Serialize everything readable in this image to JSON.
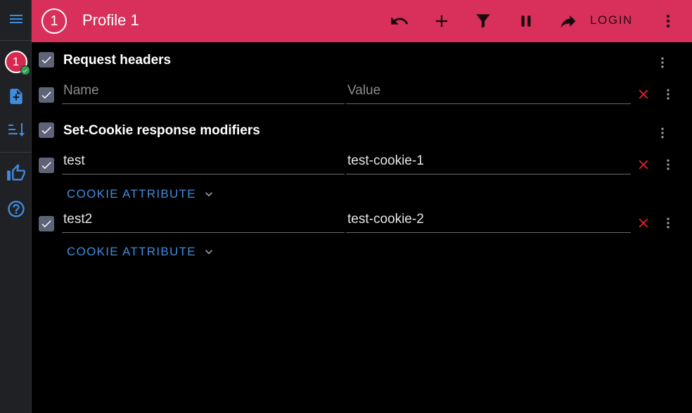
{
  "sidebar": {
    "profile_number": "1",
    "icons": [
      "menu-icon",
      "add-file-icon",
      "sort-icon",
      "thumbs-up-icon",
      "help-icon"
    ]
  },
  "topbar": {
    "profile_number": "1",
    "title": "Profile 1",
    "login_label": "LOGIN",
    "icons": [
      "undo-icon",
      "add-icon",
      "filter-icon",
      "pause-icon",
      "share-icon",
      "more-vert-icon"
    ]
  },
  "request_headers": {
    "title": "Request headers",
    "name_placeholder": "Name",
    "value_placeholder": "Value"
  },
  "cookie_modifiers": {
    "title": "Set-Cookie response modifiers",
    "rows": [
      {
        "name": "test",
        "value": "test-cookie-1",
        "attribute_label": "COOKIE ATTRIBUTE"
      },
      {
        "name": "test2",
        "value": "test-cookie-2",
        "attribute_label": "COOKIE ATTRIBUTE"
      }
    ]
  },
  "colors": {
    "topbar": "#d8305a",
    "sidebar": "#1f2124",
    "accent_blue": "#3f8de0",
    "delete_red": "#e8202a",
    "checkbox": "#5f6377"
  }
}
